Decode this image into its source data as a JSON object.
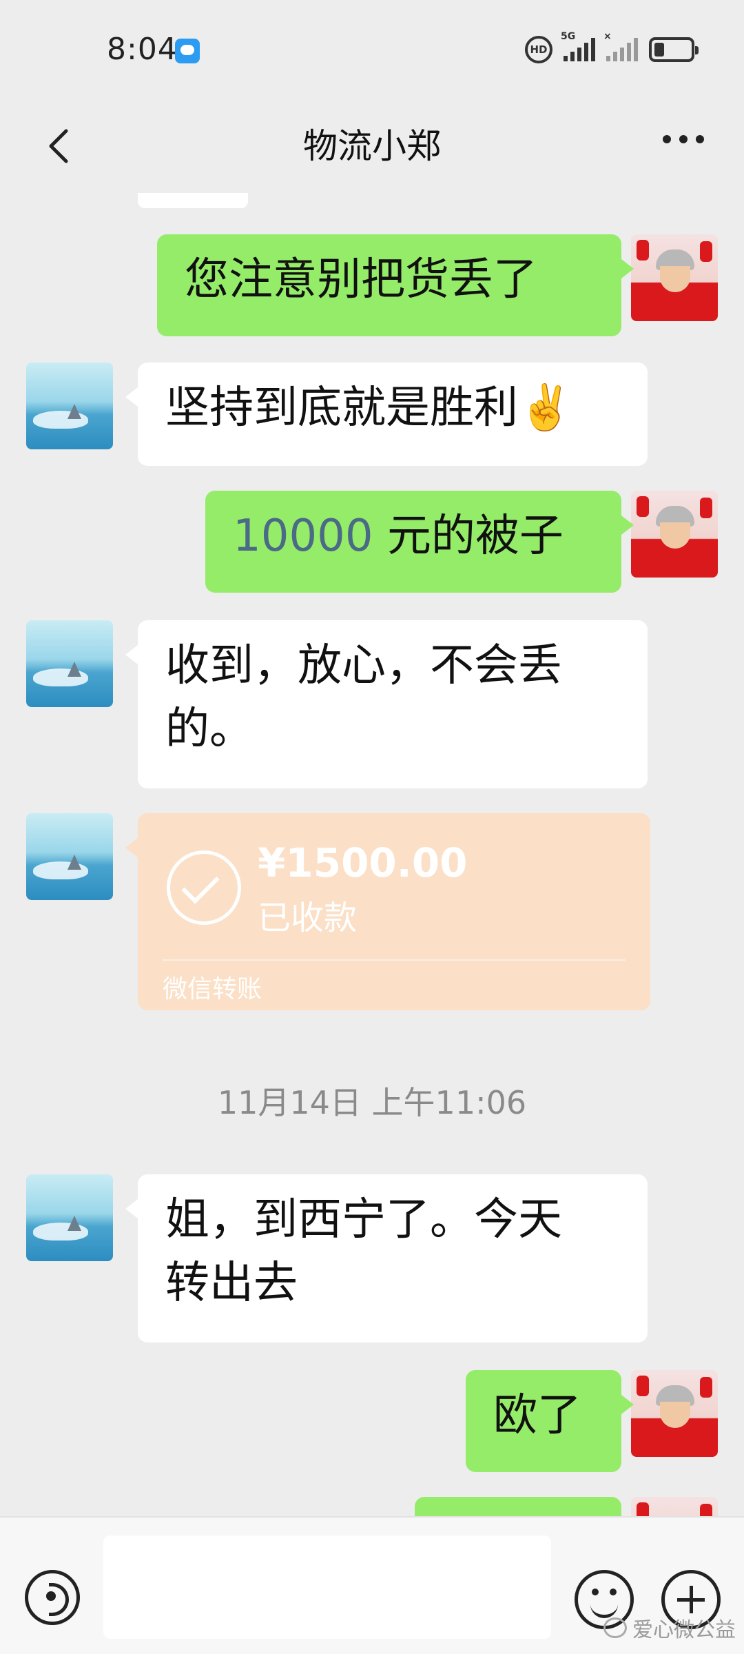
{
  "status_bar": {
    "time": "8:04",
    "network_hd": "HD",
    "network_5g": "5G",
    "signal_x": "×"
  },
  "nav": {
    "title": "物流小郑"
  },
  "messages": [
    {
      "side": "self",
      "text": "您注意别把货丢了"
    },
    {
      "side": "peer",
      "text": "坚持到底就是胜利✌️"
    },
    {
      "side": "self",
      "number": "10000",
      "text": " 元的被子"
    },
    {
      "side": "peer",
      "line1": "收到，放心，不会丢",
      "line2": "的。"
    },
    {
      "side": "peer",
      "type": "transfer",
      "amount": "¥1500.00",
      "status": "已收款",
      "label": "微信转账"
    },
    {
      "type": "timestamp",
      "text": "11月14日 上午11:06"
    },
    {
      "side": "peer",
      "line1": "姐，到西宁了。今天",
      "line2": "转出去"
    },
    {
      "side": "self",
      "text": "欧了"
    }
  ],
  "input_bar": {
    "placeholder": ""
  },
  "watermark": {
    "text": "爱心微公益"
  }
}
